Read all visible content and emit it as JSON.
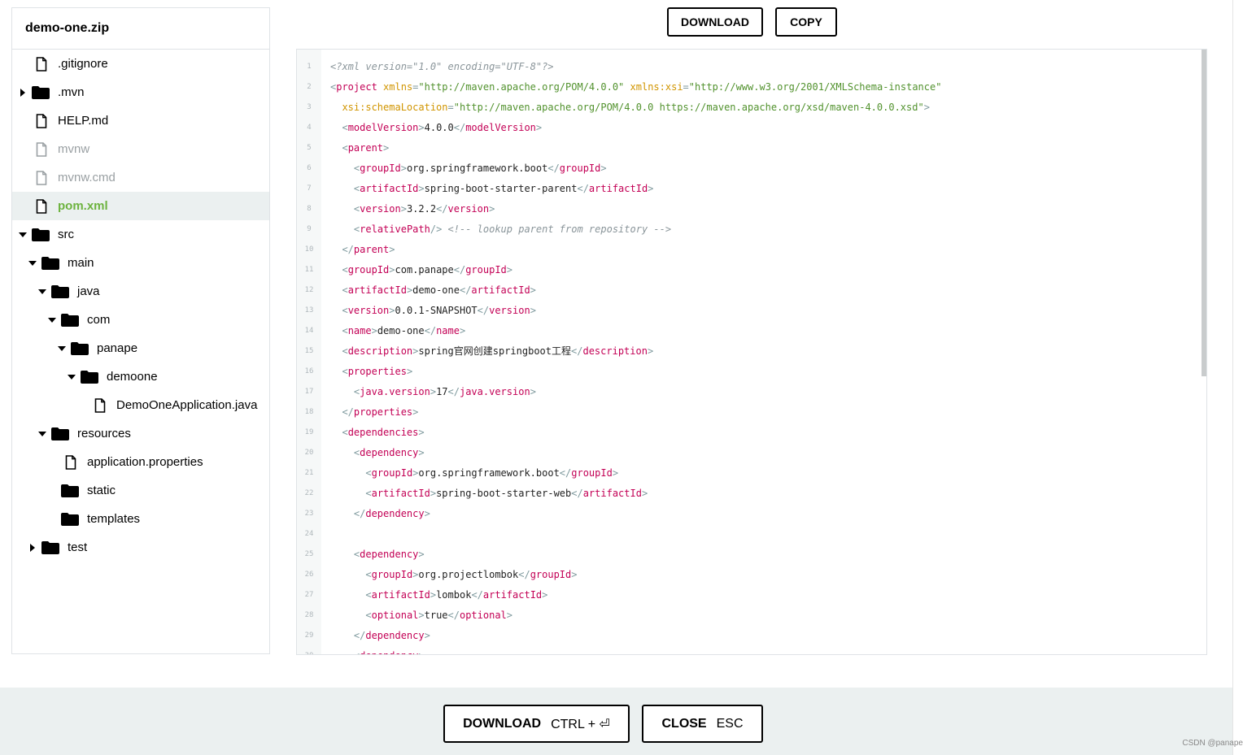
{
  "sidebar": {
    "title": "demo-one.zip",
    "tree": [
      {
        "label": ".gitignore",
        "type": "file",
        "depth": 0
      },
      {
        "label": ".mvn",
        "type": "folder",
        "depth": 0,
        "arrow": "right"
      },
      {
        "label": "HELP.md",
        "type": "file",
        "depth": 0
      },
      {
        "label": "mvnw",
        "type": "file",
        "depth": 0,
        "disabled": true
      },
      {
        "label": "mvnw.cmd",
        "type": "file",
        "depth": 0,
        "disabled": true
      },
      {
        "label": "pom.xml",
        "type": "file",
        "depth": 0,
        "selected": true
      },
      {
        "label": "src",
        "type": "folder",
        "depth": 0,
        "arrow": "down"
      },
      {
        "label": "main",
        "type": "folder",
        "depth": 1,
        "arrow": "down"
      },
      {
        "label": "java",
        "type": "folder",
        "depth": 2,
        "arrow": "down"
      },
      {
        "label": "com",
        "type": "folder",
        "depth": 3,
        "arrow": "down"
      },
      {
        "label": "panape",
        "type": "folder",
        "depth": 4,
        "arrow": "down"
      },
      {
        "label": "demoone",
        "type": "folder",
        "depth": 5,
        "arrow": "down"
      },
      {
        "label": "DemoOneApplication.java",
        "type": "file",
        "depth": 6
      },
      {
        "label": "resources",
        "type": "folder",
        "depth": 2,
        "arrow": "down"
      },
      {
        "label": "application.properties",
        "type": "file",
        "depth": 3
      },
      {
        "label": "static",
        "type": "folder",
        "depth": 3
      },
      {
        "label": "templates",
        "type": "folder",
        "depth": 3
      },
      {
        "label": "test",
        "type": "folder",
        "depth": 1,
        "arrow": "right"
      }
    ]
  },
  "toolbar": {
    "download_label": "DOWNLOAD",
    "copy_label": "COPY"
  },
  "code": {
    "lines": [
      [
        [
          "pi",
          "<?xml version=\"1.0\" encoding=\"UTF-8\"?>"
        ]
      ],
      [
        [
          "b",
          "<"
        ],
        [
          "t",
          "project"
        ],
        [
          "x",
          " "
        ],
        [
          "a",
          "xmlns"
        ],
        [
          "b",
          "="
        ],
        [
          "s",
          "\"http://maven.apache.org/POM/4.0.0\""
        ],
        [
          "x",
          " "
        ],
        [
          "a",
          "xmlns:xsi"
        ],
        [
          "b",
          "="
        ],
        [
          "s",
          "\"http://www.w3.org/2001/XMLSchema-instance\""
        ]
      ],
      [
        [
          "x",
          "  "
        ],
        [
          "a",
          "xsi:schemaLocation"
        ],
        [
          "b",
          "="
        ],
        [
          "s",
          "\"http://maven.apache.org/POM/4.0.0 https://maven.apache.org/xsd/maven-4.0.0.xsd\""
        ],
        [
          "b",
          ">"
        ]
      ],
      [
        [
          "x",
          "  "
        ],
        [
          "b",
          "<"
        ],
        [
          "t",
          "modelVersion"
        ],
        [
          "b",
          ">"
        ],
        [
          "x",
          "4.0.0"
        ],
        [
          "b",
          "</"
        ],
        [
          "t",
          "modelVersion"
        ],
        [
          "b",
          ">"
        ]
      ],
      [
        [
          "x",
          "  "
        ],
        [
          "b",
          "<"
        ],
        [
          "t",
          "parent"
        ],
        [
          "b",
          ">"
        ]
      ],
      [
        [
          "x",
          "    "
        ],
        [
          "b",
          "<"
        ],
        [
          "t",
          "groupId"
        ],
        [
          "b",
          ">"
        ],
        [
          "x",
          "org.springframework.boot"
        ],
        [
          "b",
          "</"
        ],
        [
          "t",
          "groupId"
        ],
        [
          "b",
          ">"
        ]
      ],
      [
        [
          "x",
          "    "
        ],
        [
          "b",
          "<"
        ],
        [
          "t",
          "artifactId"
        ],
        [
          "b",
          ">"
        ],
        [
          "x",
          "spring-boot-starter-parent"
        ],
        [
          "b",
          "</"
        ],
        [
          "t",
          "artifactId"
        ],
        [
          "b",
          ">"
        ]
      ],
      [
        [
          "x",
          "    "
        ],
        [
          "b",
          "<"
        ],
        [
          "t",
          "version"
        ],
        [
          "b",
          ">"
        ],
        [
          "x",
          "3.2.2"
        ],
        [
          "b",
          "</"
        ],
        [
          "t",
          "version"
        ],
        [
          "b",
          ">"
        ]
      ],
      [
        [
          "x",
          "    "
        ],
        [
          "b",
          "<"
        ],
        [
          "t",
          "relativePath"
        ],
        [
          "b",
          "/>"
        ],
        [
          "x",
          " "
        ],
        [
          "c",
          "<!-- lookup parent from repository -->"
        ]
      ],
      [
        [
          "x",
          "  "
        ],
        [
          "b",
          "</"
        ],
        [
          "t",
          "parent"
        ],
        [
          "b",
          ">"
        ]
      ],
      [
        [
          "x",
          "  "
        ],
        [
          "b",
          "<"
        ],
        [
          "t",
          "groupId"
        ],
        [
          "b",
          ">"
        ],
        [
          "x",
          "com.panape"
        ],
        [
          "b",
          "</"
        ],
        [
          "t",
          "groupId"
        ],
        [
          "b",
          ">"
        ]
      ],
      [
        [
          "x",
          "  "
        ],
        [
          "b",
          "<"
        ],
        [
          "t",
          "artifactId"
        ],
        [
          "b",
          ">"
        ],
        [
          "x",
          "demo-one"
        ],
        [
          "b",
          "</"
        ],
        [
          "t",
          "artifactId"
        ],
        [
          "b",
          ">"
        ]
      ],
      [
        [
          "x",
          "  "
        ],
        [
          "b",
          "<"
        ],
        [
          "t",
          "version"
        ],
        [
          "b",
          ">"
        ],
        [
          "x",
          "0.0.1-SNAPSHOT"
        ],
        [
          "b",
          "</"
        ],
        [
          "t",
          "version"
        ],
        [
          "b",
          ">"
        ]
      ],
      [
        [
          "x",
          "  "
        ],
        [
          "b",
          "<"
        ],
        [
          "t",
          "name"
        ],
        [
          "b",
          ">"
        ],
        [
          "x",
          "demo-one"
        ],
        [
          "b",
          "</"
        ],
        [
          "t",
          "name"
        ],
        [
          "b",
          ">"
        ]
      ],
      [
        [
          "x",
          "  "
        ],
        [
          "b",
          "<"
        ],
        [
          "t",
          "description"
        ],
        [
          "b",
          ">"
        ],
        [
          "x",
          "spring官网创建springboot工程"
        ],
        [
          "b",
          "</"
        ],
        [
          "t",
          "description"
        ],
        [
          "b",
          ">"
        ]
      ],
      [
        [
          "x",
          "  "
        ],
        [
          "b",
          "<"
        ],
        [
          "t",
          "properties"
        ],
        [
          "b",
          ">"
        ]
      ],
      [
        [
          "x",
          "    "
        ],
        [
          "b",
          "<"
        ],
        [
          "t",
          "java.version"
        ],
        [
          "b",
          ">"
        ],
        [
          "x",
          "17"
        ],
        [
          "b",
          "</"
        ],
        [
          "t",
          "java.version"
        ],
        [
          "b",
          ">"
        ]
      ],
      [
        [
          "x",
          "  "
        ],
        [
          "b",
          "</"
        ],
        [
          "t",
          "properties"
        ],
        [
          "b",
          ">"
        ]
      ],
      [
        [
          "x",
          "  "
        ],
        [
          "b",
          "<"
        ],
        [
          "t",
          "dependencies"
        ],
        [
          "b",
          ">"
        ]
      ],
      [
        [
          "x",
          "    "
        ],
        [
          "b",
          "<"
        ],
        [
          "t",
          "dependency"
        ],
        [
          "b",
          ">"
        ]
      ],
      [
        [
          "x",
          "      "
        ],
        [
          "b",
          "<"
        ],
        [
          "t",
          "groupId"
        ],
        [
          "b",
          ">"
        ],
        [
          "x",
          "org.springframework.boot"
        ],
        [
          "b",
          "</"
        ],
        [
          "t",
          "groupId"
        ],
        [
          "b",
          ">"
        ]
      ],
      [
        [
          "x",
          "      "
        ],
        [
          "b",
          "<"
        ],
        [
          "t",
          "artifactId"
        ],
        [
          "b",
          ">"
        ],
        [
          "x",
          "spring-boot-starter-web"
        ],
        [
          "b",
          "</"
        ],
        [
          "t",
          "artifactId"
        ],
        [
          "b",
          ">"
        ]
      ],
      [
        [
          "x",
          "    "
        ],
        [
          "b",
          "</"
        ],
        [
          "t",
          "dependency"
        ],
        [
          "b",
          ">"
        ]
      ],
      [],
      [
        [
          "x",
          "    "
        ],
        [
          "b",
          "<"
        ],
        [
          "t",
          "dependency"
        ],
        [
          "b",
          ">"
        ]
      ],
      [
        [
          "x",
          "      "
        ],
        [
          "b",
          "<"
        ],
        [
          "t",
          "groupId"
        ],
        [
          "b",
          ">"
        ],
        [
          "x",
          "org.projectlombok"
        ],
        [
          "b",
          "</"
        ],
        [
          "t",
          "groupId"
        ],
        [
          "b",
          ">"
        ]
      ],
      [
        [
          "x",
          "      "
        ],
        [
          "b",
          "<"
        ],
        [
          "t",
          "artifactId"
        ],
        [
          "b",
          ">"
        ],
        [
          "x",
          "lombok"
        ],
        [
          "b",
          "</"
        ],
        [
          "t",
          "artifactId"
        ],
        [
          "b",
          ">"
        ]
      ],
      [
        [
          "x",
          "      "
        ],
        [
          "b",
          "<"
        ],
        [
          "t",
          "optional"
        ],
        [
          "b",
          ">"
        ],
        [
          "x",
          "true"
        ],
        [
          "b",
          "</"
        ],
        [
          "t",
          "optional"
        ],
        [
          "b",
          ">"
        ]
      ],
      [
        [
          "x",
          "    "
        ],
        [
          "b",
          "</"
        ],
        [
          "t",
          "dependency"
        ],
        [
          "b",
          ">"
        ]
      ],
      [
        [
          "x",
          "    "
        ],
        [
          "b",
          "<"
        ],
        [
          "t",
          "dependency"
        ],
        [
          "b",
          ">"
        ]
      ]
    ]
  },
  "footer": {
    "download_label": "DOWNLOAD",
    "download_hint": "CTRL + ⏎",
    "close_label": "CLOSE",
    "close_hint": "ESC"
  },
  "watermark": "CSDN @panape",
  "colors": {
    "accent_green": "#6db33f",
    "tag": "#c30055",
    "attr": "#d19500",
    "string": "#52922e",
    "footer_bg": "#ebf0f0"
  }
}
